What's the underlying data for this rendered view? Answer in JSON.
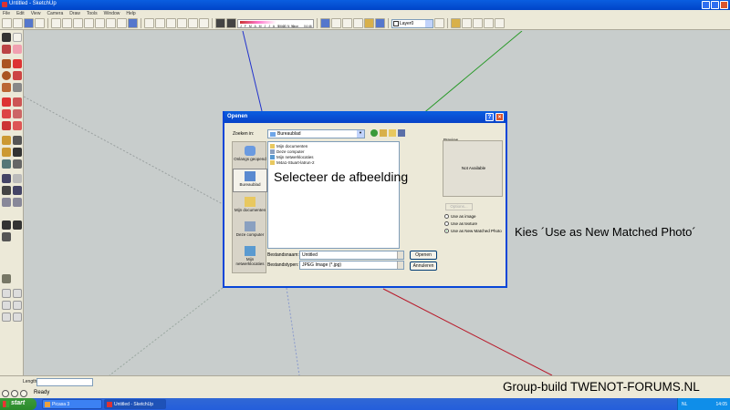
{
  "app": {
    "window_title": "Untitled - SketchUp",
    "menu": [
      "File",
      "Edit",
      "View",
      "Camera",
      "Draw",
      "Tools",
      "Window",
      "Help"
    ]
  },
  "toolbar": {
    "shadow_months": "J F M A M J J A S O N D",
    "shadow_time_start": "06:43",
    "shadow_time_mid": "Noon",
    "shadow_time_end": "04:46",
    "layer": "Layer0"
  },
  "status_bar": {
    "vcb_label": "Length",
    "vcb_value": "",
    "status_text": "Ready"
  },
  "taskbar": {
    "start_label": "start",
    "tasks": [
      "Picasa 3",
      "Untitled - SketchUp"
    ],
    "tray_lang": "NL",
    "tray_clock": "14:05"
  },
  "annotations": {
    "select_image": "Selecteer de afbeelding",
    "choose_option": "Kies ´Use as New Matched Photo´",
    "credit": "Group-build TWENOT-FORUMS.NL"
  },
  "dialog": {
    "title": "Openen",
    "look_in_label": "Zoeken in:",
    "look_in_value": "Bureaublad",
    "places": [
      "Onlangs geopend",
      "Bureaublad",
      "Mijn documenten",
      "Deze computer",
      "Mijn netwerklocaties"
    ],
    "files": [
      "Mijn documenten",
      "Deze computer",
      "Mijn netwerklocaties",
      "M4a1-Stuart-latrun-2"
    ],
    "file_name_label": "Bestandsnaam:",
    "file_name_value": "Untitled",
    "file_type_label": "Bestandstypen:",
    "file_type_value": "JPEG Image (*.jpg)",
    "open_button": "Openen",
    "cancel_button": "Annuleren",
    "preview_label": "Preview",
    "preview_text": "Not Available",
    "options_button": "Options...",
    "radio_options": [
      "Use as image",
      "Use as texture",
      "Use as New Matched Photo"
    ],
    "selected_radio": 2
  }
}
